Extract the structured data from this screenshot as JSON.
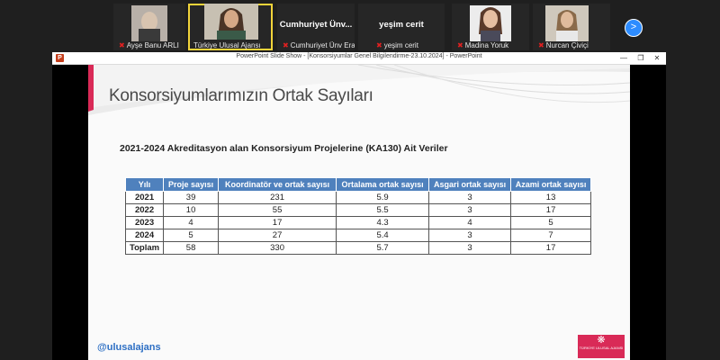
{
  "participants": [
    {
      "name": "Ayşe Banu ARLI",
      "muted": true
    },
    {
      "name": "Türkiye Ulusal Ajansı",
      "muted": false,
      "active": true
    },
    {
      "name": "Cumhuriyet Ünv Eras...",
      "big": "Cumhuriyet Ünv...",
      "muted": true
    },
    {
      "name": "yeşim cerit",
      "big": "yeşim cerit",
      "muted": true
    },
    {
      "name": "Madina Yoruk",
      "muted": true
    },
    {
      "name": "Nurcan Çiviçi",
      "muted": true
    }
  ],
  "next_icon": "chevron-right-icon",
  "window": {
    "title": "PowerPoint Slide Show - [Konsorsiyumlar Genel Bilgilendirme-23.10.2024] - PowerPoint",
    "app_icon": "P",
    "minimize": "—",
    "restore": "❐",
    "close": "✕"
  },
  "slide": {
    "title": "Konsorsiyumlarımızın Ortak Sayıları",
    "subtitle": "2021-2024 Akreditasyon alan Konsorsiyum Projelerine (KA130) Ait Veriler",
    "handle": "@ulusalajans",
    "logo_text": "TÜRKİYE ULUSAL AJANSI"
  },
  "table": {
    "headers": [
      "Yılı",
      "Proje sayısı",
      "Koordinatör ve ortak sayısı",
      "Ortalama ortak sayısı",
      "Asgari ortak sayısı",
      "Azami ortak sayısı"
    ],
    "rows": [
      [
        "2021",
        "39",
        "231",
        "5.9",
        "3",
        "13"
      ],
      [
        "2022",
        "10",
        "55",
        "5.5",
        "3",
        "17"
      ],
      [
        "2023",
        "4",
        "17",
        "4.3",
        "4",
        "5"
      ],
      [
        "2024",
        "5",
        "27",
        "5.4",
        "3",
        "7"
      ],
      [
        "Toplam",
        "58",
        "330",
        "5.7",
        "3",
        "17"
      ]
    ]
  },
  "colors": {
    "header_blue": "#4f81bd",
    "accent_red": "#d92a57",
    "handle_blue": "#2d6fc4"
  }
}
